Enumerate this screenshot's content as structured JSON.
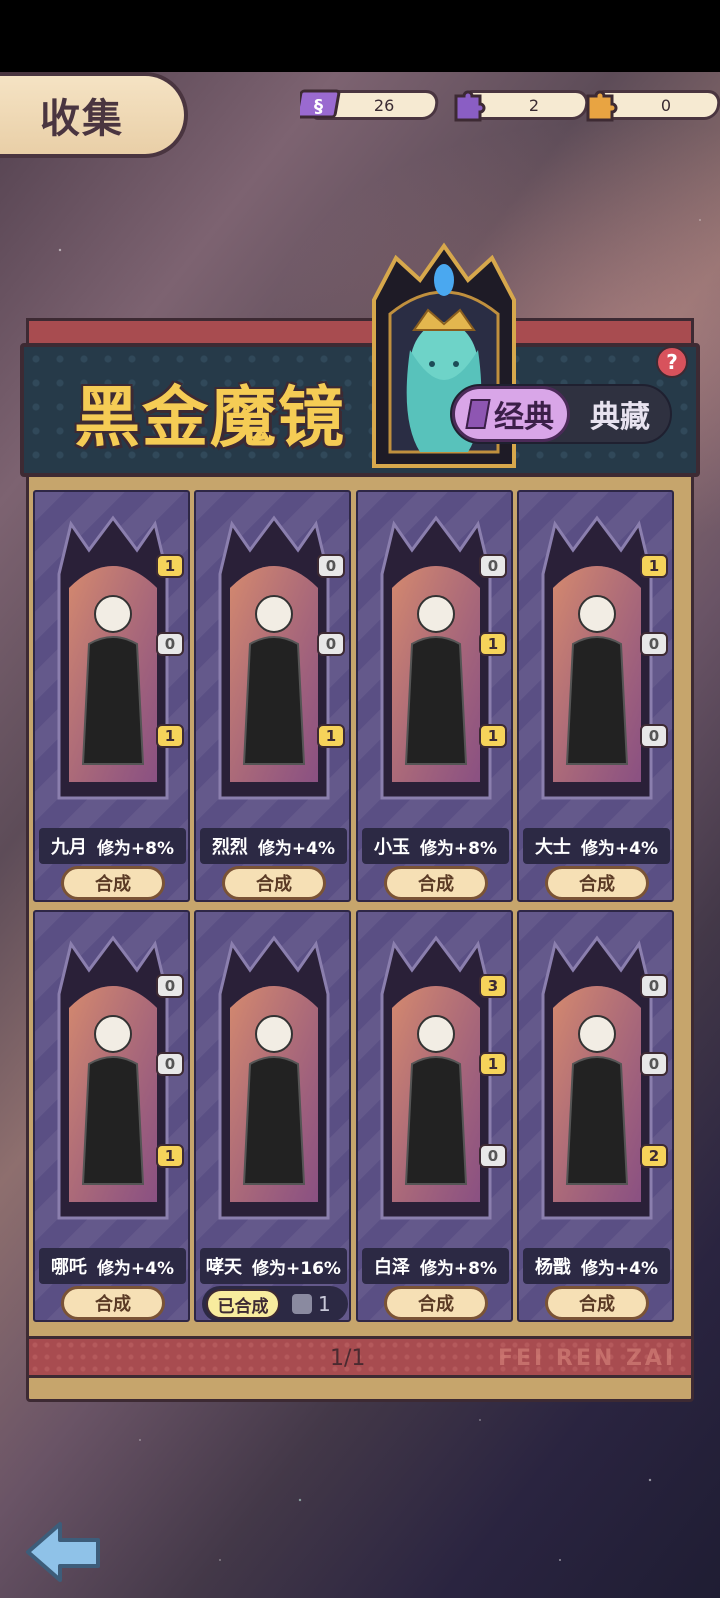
{
  "header": {
    "title": "收集"
  },
  "resources": [
    {
      "name": "ticket",
      "icon": "ticket-icon",
      "value": "26",
      "color": "#9a6ad0"
    },
    {
      "name": "purple-piece",
      "icon": "purple-puzzle-icon",
      "value": "2",
      "color": "#8a5ec4"
    },
    {
      "name": "orange-piece",
      "icon": "orange-puzzle-icon",
      "value": "0",
      "color": "#e8a442"
    }
  ],
  "banner": {
    "title": "黑金魔镜",
    "tab_active": "经典",
    "tab_other": "典藏",
    "help": "?"
  },
  "cards": [
    {
      "name": "九月",
      "bonus": "修为+8%",
      "pieces": [
        "1",
        "0",
        "1"
      ],
      "action": "合成"
    },
    {
      "name": "烈烈",
      "bonus": "修为+4%",
      "pieces": [
        "0",
        "0",
        "1"
      ],
      "action": "合成"
    },
    {
      "name": "小玉",
      "bonus": "修为+8%",
      "pieces": [
        "0",
        "1",
        "1"
      ],
      "action": "合成"
    },
    {
      "name": "大士",
      "bonus": "修为+4%",
      "pieces": [
        "1",
        "0",
        "0"
      ],
      "action": "合成"
    },
    {
      "name": "哪吒",
      "bonus": "修为+4%",
      "pieces": [
        "0",
        "0",
        "1"
      ],
      "action": "合成"
    },
    {
      "name": "哮天",
      "bonus": "修为+16%",
      "pieces": [],
      "action": "已合成",
      "owned": "1"
    },
    {
      "name": "白泽",
      "bonus": "修为+8%",
      "pieces": [
        "3",
        "1",
        "0"
      ],
      "action": "合成"
    },
    {
      "name": "杨戬",
      "bonus": "修为+4%",
      "pieces": [
        "0",
        "0",
        "2"
      ],
      "action": "合成"
    }
  ],
  "footer": {
    "pager": "1/1",
    "watermark": "FEI REN ZAI"
  }
}
